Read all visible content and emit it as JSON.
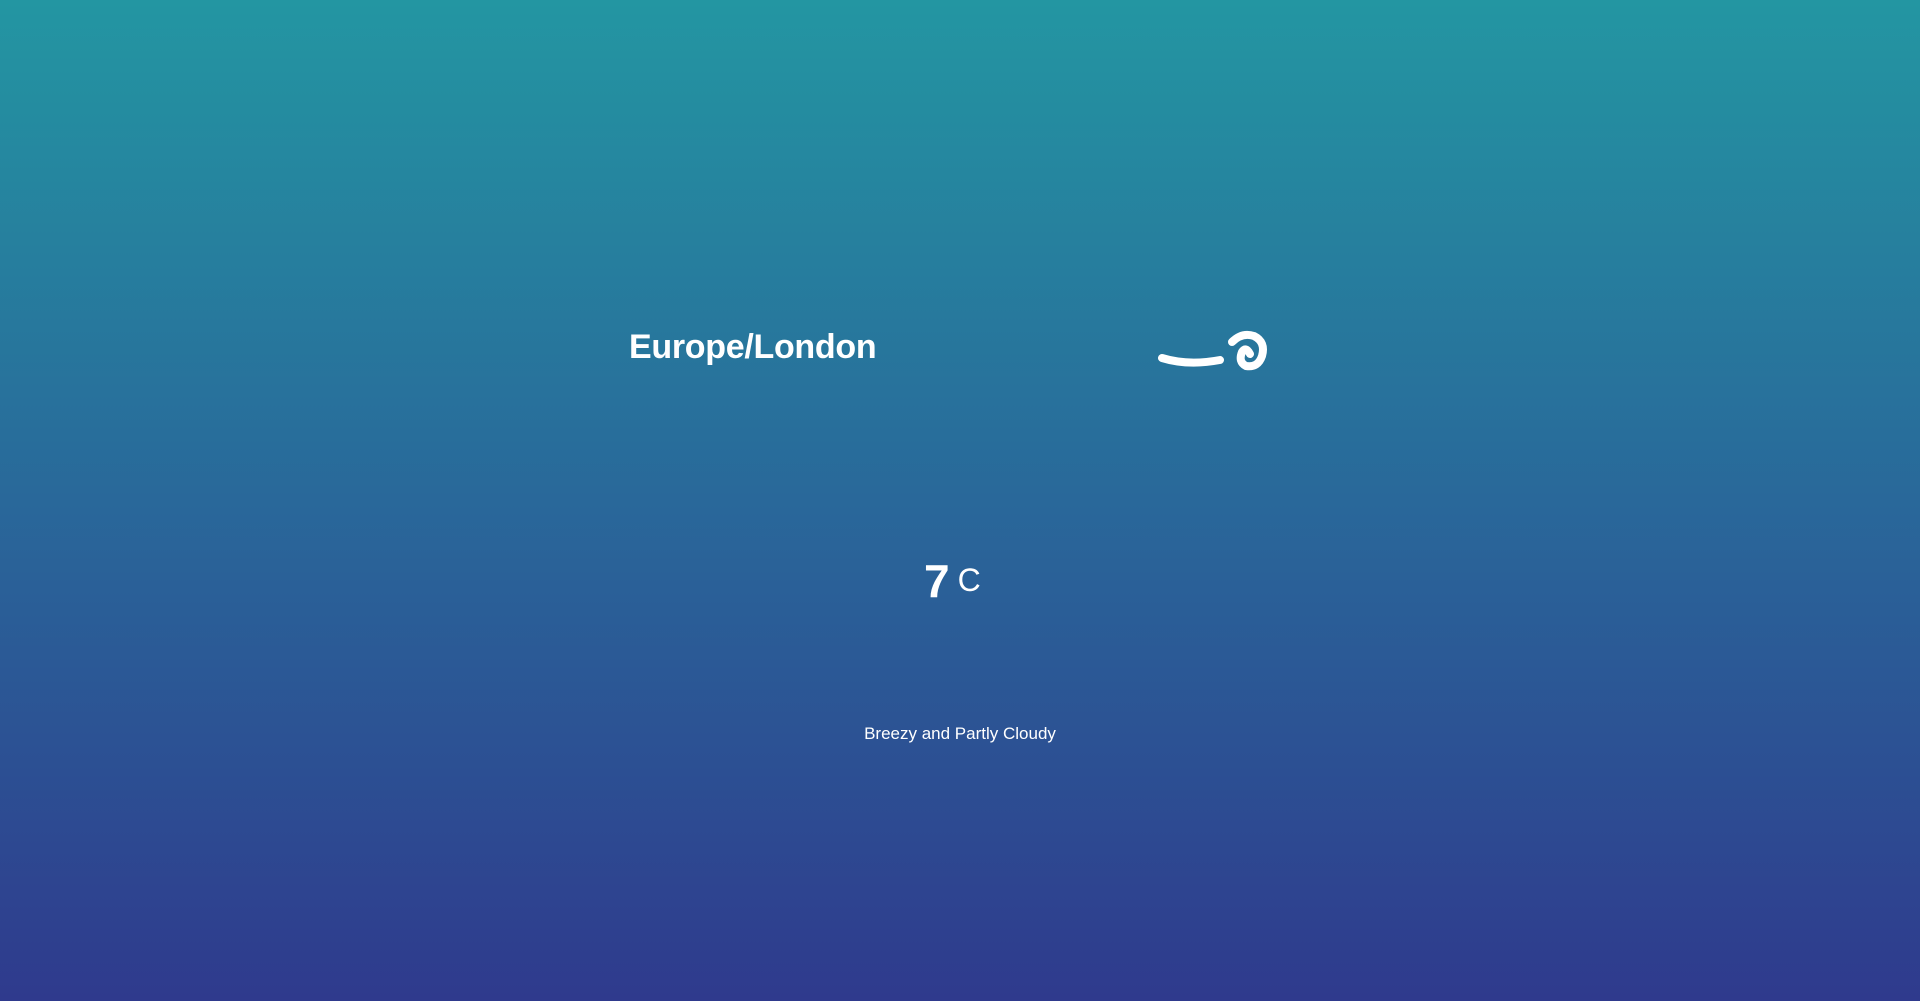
{
  "location": {
    "timezone": "Europe/London"
  },
  "current": {
    "icon": "wind-icon",
    "temperature": "7",
    "unit": "C",
    "summary": "Breezy and Partly Cloudy"
  },
  "colors": {
    "gradient_top": "#2396a2",
    "gradient_bottom": "#2f3a8d",
    "text": "#ffffff"
  }
}
